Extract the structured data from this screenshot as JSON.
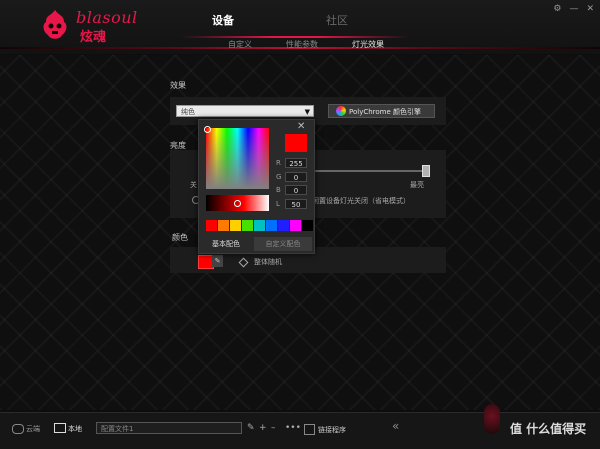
{
  "brand": {
    "name_en": "blasoul",
    "name_cn": "炫魂"
  },
  "header": {
    "tabs": [
      {
        "label": "设备"
      },
      {
        "label": "社区"
      }
    ],
    "window_controls": [
      "⚙",
      "—",
      "✕"
    ]
  },
  "subnav": {
    "items": [
      {
        "label": "自定义"
      },
      {
        "label": "性能参数"
      },
      {
        "label": "灯光效果"
      }
    ]
  },
  "effect": {
    "label": "效果",
    "selected": "纯色",
    "polychrome_label": "PolyChrome 颜色引擎"
  },
  "brightness": {
    "label": "亮度",
    "min_label": "关",
    "max_label": "最亮",
    "level": 1.0,
    "sleep_label": "闲置设备灯光关闭（省电模式）"
  },
  "color": {
    "label": "颜色",
    "swatch": "#ff0000",
    "edit_glyph": "✎",
    "random_label": "整体随机"
  },
  "picker": {
    "close": "✕",
    "preview": "#ff0000",
    "channels": [
      {
        "name": "R",
        "value": "255"
      },
      {
        "name": "G",
        "value": "0"
      },
      {
        "name": "B",
        "value": "0"
      },
      {
        "name": "L",
        "value": "50"
      }
    ],
    "presets": [
      "#ff0000",
      "#ff7a00",
      "#ffd000",
      "#48e000",
      "#00c0c0",
      "#0070ff",
      "#2020ff",
      "#ff00ff",
      "#000000"
    ],
    "tabs": [
      {
        "label": "基本配色"
      },
      {
        "label": "自定义配色"
      }
    ]
  },
  "footer": {
    "cloud_label": "云端",
    "local_label": "本地",
    "profile": "配置文件1",
    "tools": [
      "✎",
      "+",
      "–",
      "•••"
    ],
    "link_label": "链接程序",
    "collapse": "«"
  },
  "watermark": "值 什么值得买",
  "colors": {
    "accent": "#e6144a",
    "background": "#0d0d0d"
  }
}
